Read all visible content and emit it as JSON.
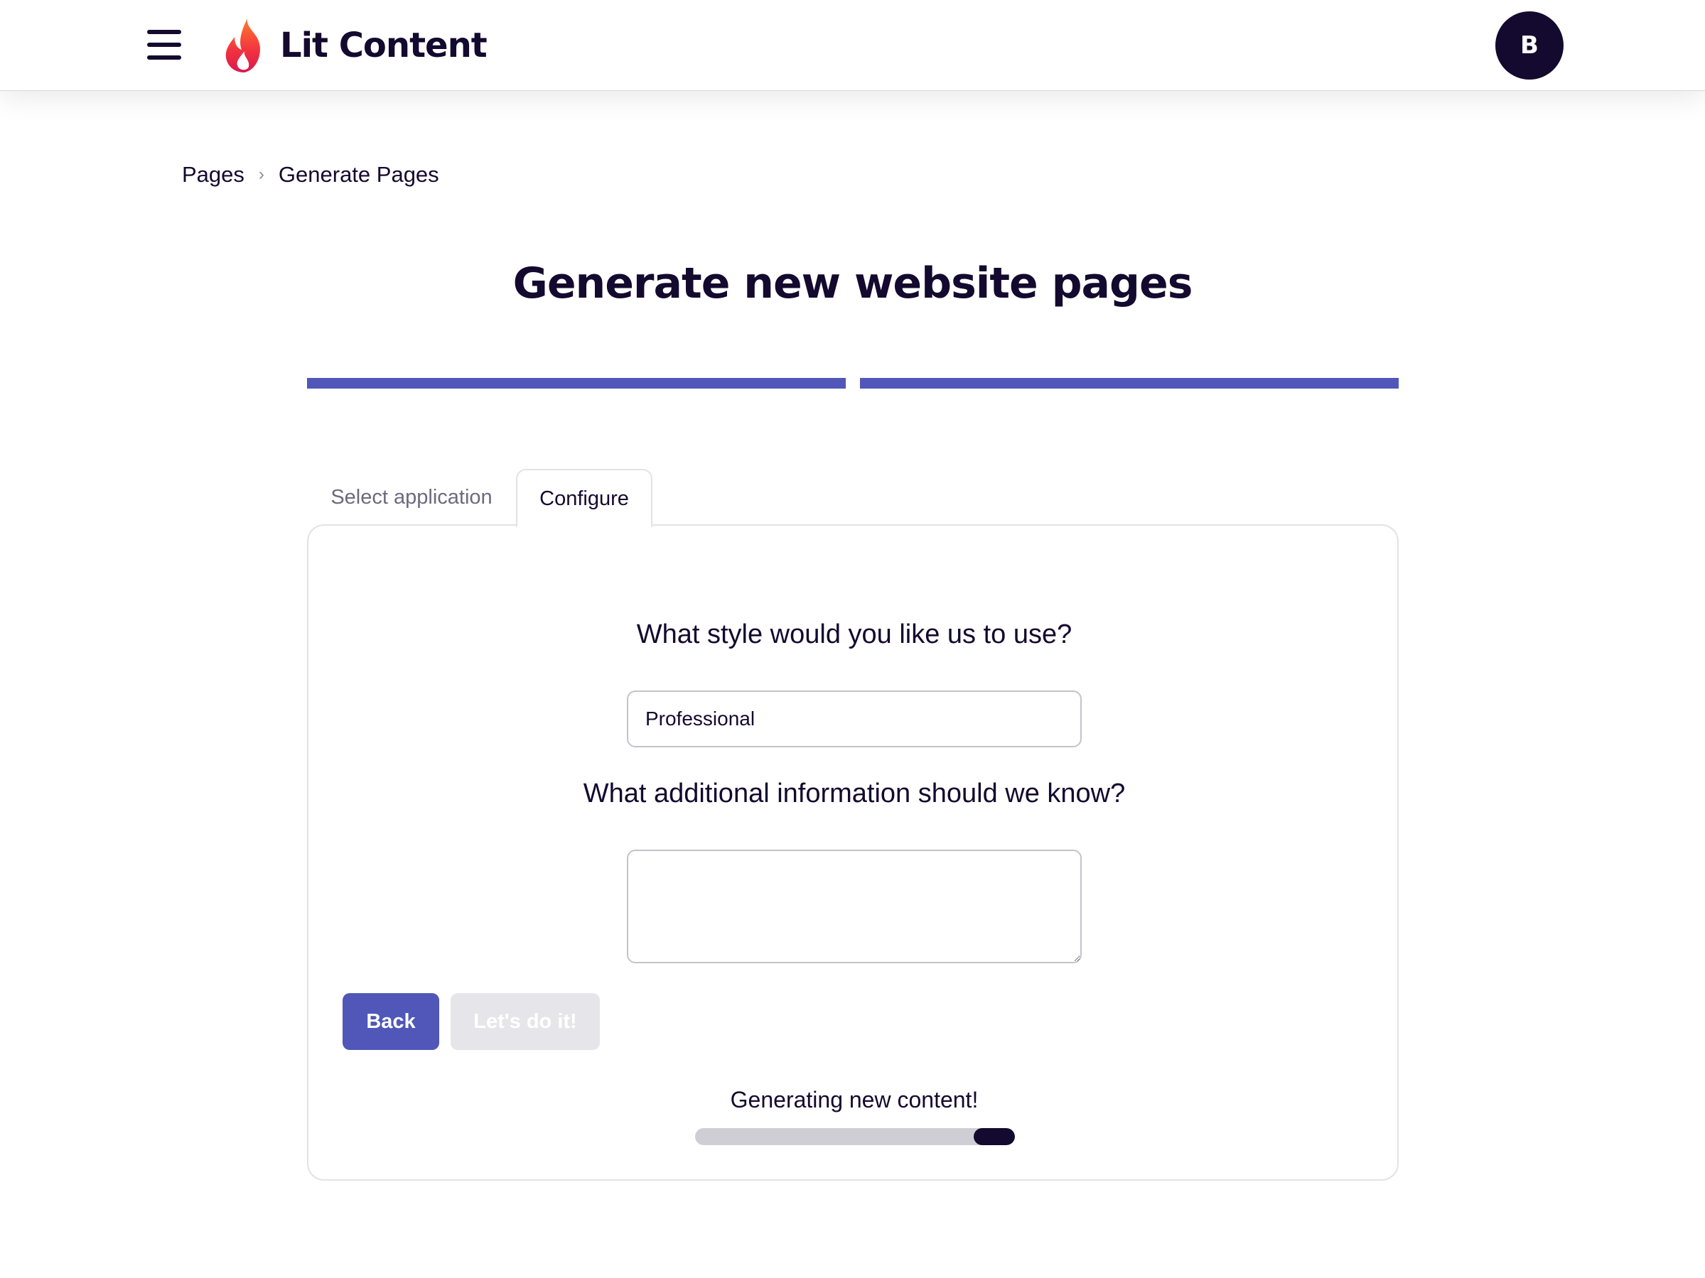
{
  "header": {
    "app_name": "Lit Content",
    "menu_icon": "hamburger-menu-icon",
    "logo_icon": "flame-icon",
    "avatar_initial": "B"
  },
  "breadcrumb": {
    "items": [
      "Pages",
      "Generate Pages"
    ],
    "separator_icon": "chevron-right-icon"
  },
  "page": {
    "title": "Generate new website pages"
  },
  "stepper": {
    "total_steps": 2,
    "completed_steps": 2,
    "color": "#5057b9"
  },
  "tabs": [
    {
      "label": "Select application",
      "active": false
    },
    {
      "label": "Configure",
      "active": true
    }
  ],
  "form": {
    "style_question": "What style would you like us to use?",
    "style_value": "Professional",
    "info_question": "What additional information should we know?",
    "info_value": ""
  },
  "buttons": {
    "back_label": "Back",
    "submit_label": "Let's do it!",
    "submit_disabled": true
  },
  "status": {
    "text": "Generating new content!",
    "progress_fill_start": 0.87,
    "progress_fill_end": 1.0
  },
  "colors": {
    "primary": "#5057b9",
    "dark": "#14092e",
    "disabled": "#e6e6ea"
  }
}
